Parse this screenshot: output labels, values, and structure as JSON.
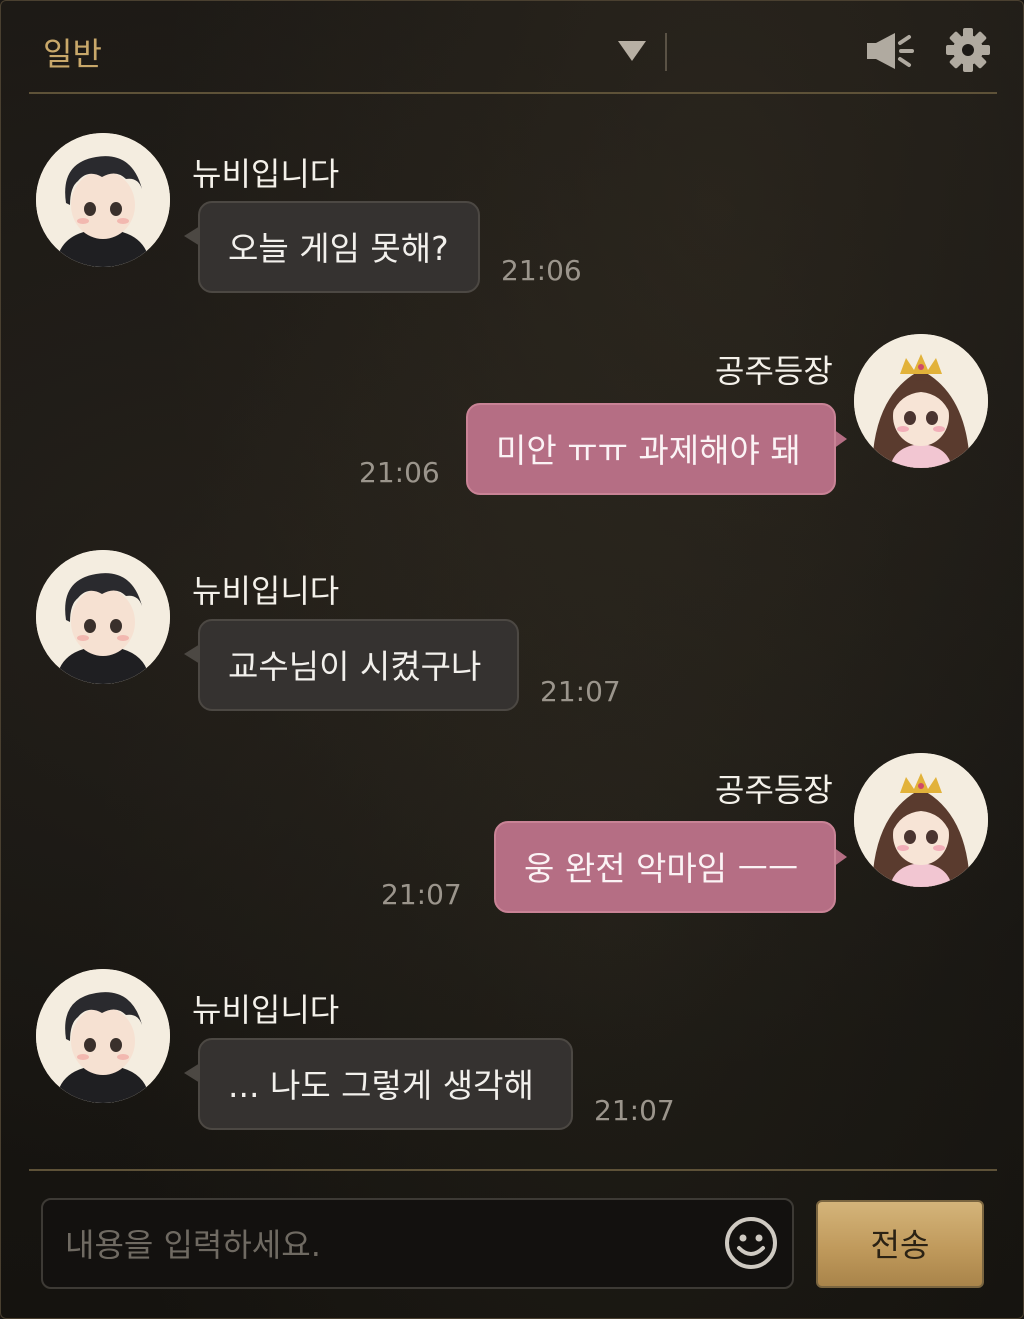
{
  "header": {
    "channel_label": "일반",
    "dropdown_icon": "triangle-down-icon",
    "speaker_icon": "speaker-icon",
    "settings_icon": "gear-icon"
  },
  "colors": {
    "accent_gold": "#c9a86a",
    "incoming_bubble": "#353230",
    "outgoing_bubble": "#b56e84",
    "send_button": "#c9a86a"
  },
  "messages": [
    {
      "direction": "incoming",
      "sender": "뉴비입니다",
      "text": "오늘 게임 못해?",
      "time": "21:06",
      "avatar": "boy-avatar"
    },
    {
      "direction": "outgoing",
      "sender": "공주등장",
      "text": "미안 ㅠㅠ 과제해야 돼",
      "time": "21:06",
      "avatar": "princess-avatar"
    },
    {
      "direction": "incoming",
      "sender": "뉴비입니다",
      "text": "교수님이 시켰구나",
      "time": "21:07",
      "avatar": "boy-avatar"
    },
    {
      "direction": "outgoing",
      "sender": "공주등장",
      "text": "웅 완전 악마임 ㅡㅡ",
      "time": "21:07",
      "avatar": "princess-avatar"
    },
    {
      "direction": "incoming",
      "sender": "뉴비입니다",
      "text": "... 나도 그렇게 생각해",
      "time": "21:07",
      "avatar": "boy-avatar"
    }
  ],
  "composer": {
    "placeholder": "내용을 입력하세요.",
    "value": "",
    "emoji_icon": "smiley-icon",
    "send_label": "전송"
  }
}
